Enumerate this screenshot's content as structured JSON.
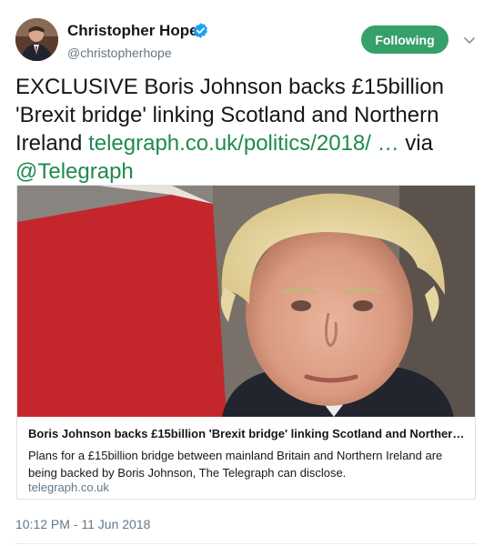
{
  "author": {
    "display_name": "Christopher Hope",
    "handle": "@christopherhope",
    "verified_icon": "verified-badge-icon",
    "avatar_icon": "profile-photo"
  },
  "header": {
    "follow_label": "Following",
    "menu_icon": "chevron-down-icon"
  },
  "tweet": {
    "text_prefix": "EXCLUSIVE Boris Johnson backs £15billion 'Brexit bridge' linking Scotland and Northern Ireland",
    "link_text": "telegraph.co.uk/politics/2018/ …",
    "via": "via",
    "mention": "@Telegraph"
  },
  "card": {
    "title": "Boris Johnson backs £15billion 'Brexit bridge' linking Scotland and Northern ...",
    "description": "Plans for a £15billion bridge between mainland Britain and Northern Ireland are being backed by Boris Johnson, The Telegraph can disclose.",
    "domain": "telegraph.co.uk",
    "image_icon": "news-photo"
  },
  "footer": {
    "timestamp": "10:12 PM - 11 Jun 2018"
  },
  "colors": {
    "follow_button": "#35a06a",
    "link": "#1f8a4c",
    "verified": "#1da1f2",
    "muted": "#657786"
  }
}
